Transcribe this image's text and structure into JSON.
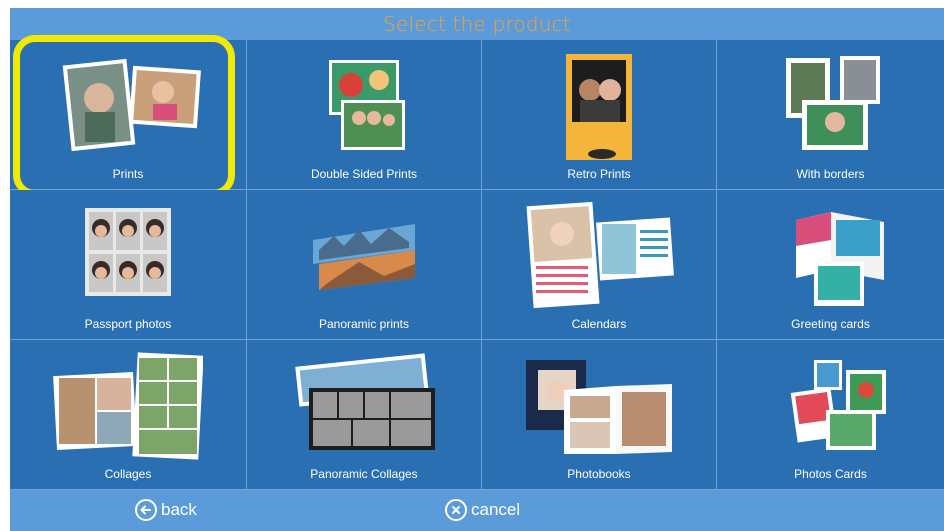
{
  "header": {
    "title": "Select the product"
  },
  "products": [
    {
      "label": "Prints",
      "icon": "prints-photo-icon",
      "selected": true
    },
    {
      "label": "Double Sided Prints",
      "icon": "double-sided-prints-icon"
    },
    {
      "label": "Retro Prints",
      "icon": "retro-prints-icon"
    },
    {
      "label": "With borders",
      "icon": "bordered-prints-icon"
    },
    {
      "label": "Passport photos",
      "icon": "passport-photos-icon"
    },
    {
      "label": "Panoramic prints",
      "icon": "panoramic-prints-icon"
    },
    {
      "label": "Calendars",
      "icon": "calendar-icon"
    },
    {
      "label": "Greeting cards",
      "icon": "greeting-card-icon"
    },
    {
      "label": "Collages",
      "icon": "collage-icon"
    },
    {
      "label": "Panoramic Collages",
      "icon": "panoramic-collage-icon"
    },
    {
      "label": "Photobooks",
      "icon": "photobook-icon"
    },
    {
      "label": "Photos Cards",
      "icon": "photo-cards-icon"
    }
  ],
  "footer": {
    "back_label": "back",
    "cancel_label": "cancel"
  },
  "colors": {
    "background": "#2c74ba",
    "bar": "#5b9bd9",
    "title": "#f0a23a",
    "selection": "#f0ea00"
  }
}
